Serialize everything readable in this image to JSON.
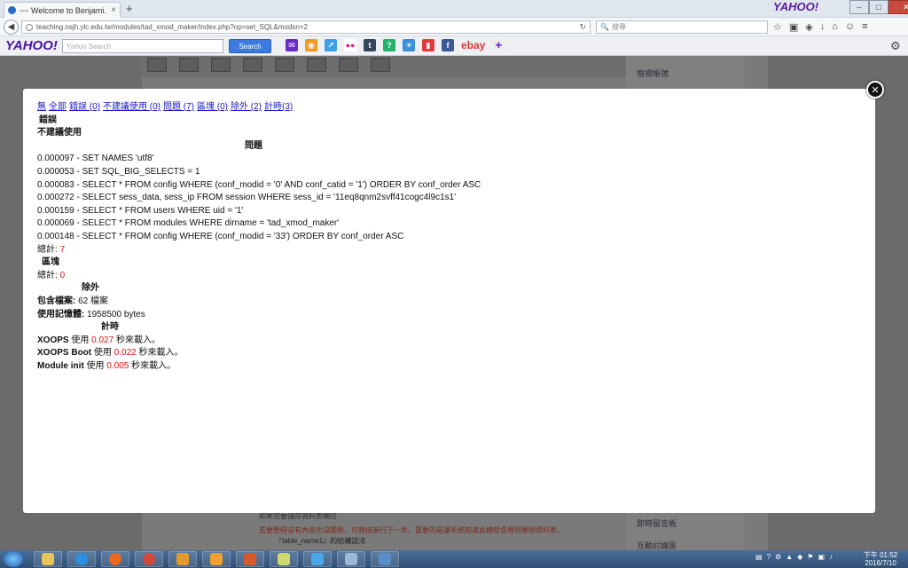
{
  "browser": {
    "tab_title": "~~ Welcome to Benjami...",
    "tab_close": "×",
    "new_tab": "+",
    "brand_top": "YAHOO!",
    "url": "teaching.nsjh.ylc.edu.tw/modules/tad_xmod_maker/index.php?op=set_SQL&modsn=2",
    "search_placeholder": "搜尋"
  },
  "yahoo_toolbar": {
    "logo": "YAHOO!",
    "search_placeholder": "Yahoo Search",
    "search_button": "Search",
    "ebay": "ebay"
  },
  "sidebar_behind": {
    "item1": "檢視帳號",
    "item2": "即時留言板",
    "item3": "互動討論區"
  },
  "bottom_behind": {
    "line1": "如果您要儲存資料表欄位",
    "line2": "若要暫時沒有內容也沒關係，可直接進行下一步，重要的是讓系統知道此模組會用到哪個資料表。",
    "line3": "『table_name1』的結構語法"
  },
  "debug": {
    "links": [
      "無",
      "全部",
      "錯誤 (0)",
      "不建議使用 (0)",
      "問題 (7)",
      "區塊 (0)",
      "除外 (2)",
      "計時(3)"
    ],
    "errors_heading": "錯誤",
    "deprecated_heading": "不建議使用",
    "queries_heading": "問題",
    "queries": [
      "0.000097 - SET NAMES 'utf8'",
      "0.000053 - SET SQL_BIG_SELECTS = 1",
      "0.000083 - SELECT * FROM config WHERE (conf_modid = '0' AND conf_catid = '1') ORDER BY conf_order ASC",
      "0.000272 - SELECT sess_data, sess_ip FROM session WHERE sess_id = '11eq8qnm2svff41cogc4l9c1s1'",
      "0.000159 - SELECT * FROM users WHERE uid = '1'",
      "0.000069 - SELECT * FROM modules WHERE dirname = 'tad_xmod_maker'",
      "0.000148 - SELECT * FROM config WHERE (conf_modid = '33') ORDER BY conf_order ASC"
    ],
    "total_label": "總計:",
    "queries_total": "7",
    "blocks_heading": "區塊",
    "blocks_total": "0",
    "extra_heading": "除外",
    "included_files_label": "包含檔案:",
    "included_files_value": "62 檔案",
    "memory_label": "使用記憶體:",
    "memory_value": "1958500 bytes",
    "timers_heading": "計時",
    "timers": [
      {
        "name": "XOOPS",
        "pre": "使用",
        "value": "0.027",
        "post": "秒來載入。"
      },
      {
        "name": "XOOPS Boot",
        "pre": "使用",
        "value": "0.022",
        "post": "秒來載入。"
      },
      {
        "name": "Module init",
        "pre": "使用",
        "value": "0.005",
        "post": "秒來載入。"
      }
    ]
  },
  "taskbar": {
    "time": "下午 01:52",
    "date": "2016/7/10"
  },
  "colors": {
    "link": "#1a1acc",
    "highlight": "#dd1111",
    "yahoo_purple": "#4b13a1"
  }
}
